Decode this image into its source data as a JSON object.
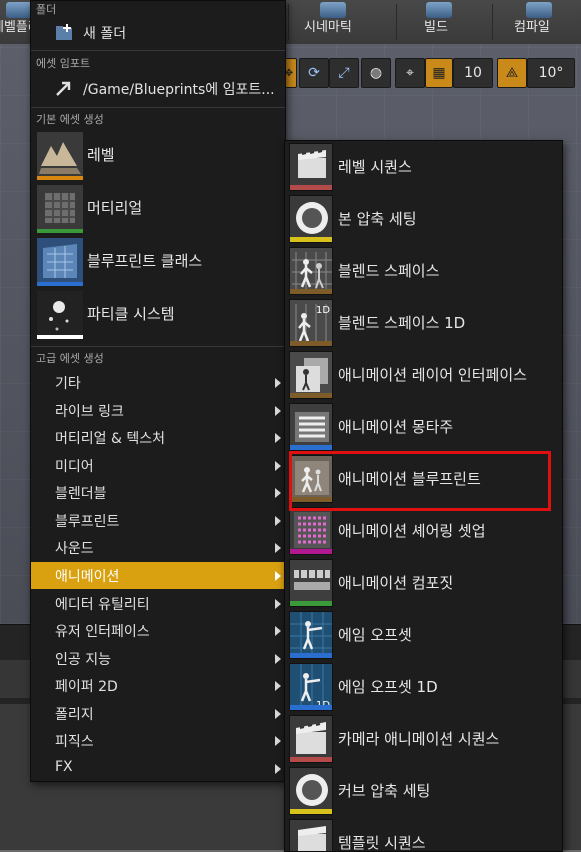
{
  "toolbar": {
    "partial_left_label": "레벨플러",
    "cinematic_label": "시네마틱",
    "build_label": "빌드",
    "compile_label": "컴파일"
  },
  "viewport_bar": {
    "grid_snap_value": "10",
    "rotation_snap_value": "10°"
  },
  "menu": {
    "folder_section": "폴더",
    "new_folder": "새 폴더",
    "import_section": "에셋 임포트",
    "import_item": "/Game/Blueprints에 임포트...",
    "basic_section": "기본 에셋 생성",
    "basic_items": [
      {
        "label": "레벨",
        "icon": "level-icon"
      },
      {
        "label": "머티리얼",
        "icon": "material-icon"
      },
      {
        "label": "블루프린트 클래스",
        "icon": "blueprint-class-icon"
      },
      {
        "label": "파티클 시스템",
        "icon": "particle-system-icon"
      }
    ],
    "advanced_section": "고급 에셋 생성",
    "categories": [
      {
        "label": "기타",
        "selected": false
      },
      {
        "label": "라이브 링크",
        "selected": false
      },
      {
        "label": "머티리얼 & 텍스처",
        "selected": false
      },
      {
        "label": "미디어",
        "selected": false
      },
      {
        "label": "블렌더블",
        "selected": false
      },
      {
        "label": "블루프린트",
        "selected": false
      },
      {
        "label": "사운드",
        "selected": false
      },
      {
        "label": "애니메이션",
        "selected": true
      },
      {
        "label": "에디터 유틸리티",
        "selected": false
      },
      {
        "label": "유저 인터페이스",
        "selected": false
      },
      {
        "label": "인공 지능",
        "selected": false
      },
      {
        "label": "페이퍼 2D",
        "selected": false
      },
      {
        "label": "폴리지",
        "selected": false
      },
      {
        "label": "피직스",
        "selected": false
      },
      {
        "label": "FX",
        "selected": false
      }
    ],
    "selected_color": "#d9a010"
  },
  "submenu": {
    "items": [
      {
        "label": "레벨 시퀀스",
        "icon": "level-sequence-icon"
      },
      {
        "label": "본 압축 세팅",
        "icon": "bone-compression-icon"
      },
      {
        "label": "블렌드 스페이스",
        "icon": "blend-space-icon"
      },
      {
        "label": "블렌드 스페이스 1D",
        "icon": "blend-space-1d-icon",
        "badge": "1D"
      },
      {
        "label": "애니메이션 레이어 인터페이스",
        "icon": "anim-layer-interface-icon"
      },
      {
        "label": "애니메이션 몽타주",
        "icon": "anim-montage-icon"
      },
      {
        "label": "애니메이션 블루프린트",
        "icon": "anim-blueprint-icon"
      },
      {
        "label": "애니메이션 셰어링 셋업",
        "icon": "anim-sharing-setup-icon"
      },
      {
        "label": "애니메이션 컴포짓",
        "icon": "anim-composite-icon"
      },
      {
        "label": "에임 오프셋",
        "icon": "aim-offset-icon"
      },
      {
        "label": "에임 오프셋 1D",
        "icon": "aim-offset-1d-icon",
        "badge": "1D"
      },
      {
        "label": "카메라 애니메이션 시퀀스",
        "icon": "camera-anim-sequence-icon"
      },
      {
        "label": "커브 압축 세팅",
        "icon": "curve-compression-icon"
      },
      {
        "label": "템플릿 시퀀스",
        "icon": "template-sequence-icon"
      }
    ],
    "highlight_color": "#e01010"
  },
  "colors": {
    "stripe_anim": "#7d5c2a",
    "stripe_level_seq": "#b34a4a",
    "stripe_yellow": "#d6c21a",
    "stripe_magenta": "#b0198f",
    "stripe_green": "#3a9a3a",
    "stripe_blue": "#2a6fd0",
    "stripe_orange": "#d9880f"
  }
}
